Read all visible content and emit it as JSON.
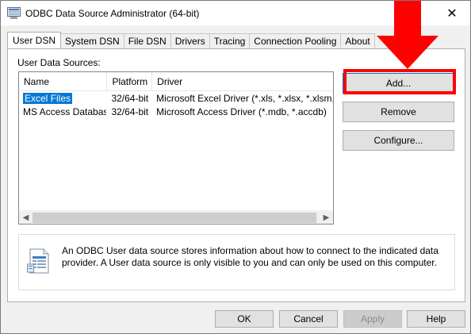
{
  "window": {
    "title": "ODBC Data Source Administrator (64-bit)",
    "close_glyph": "✕"
  },
  "tabs": [
    {
      "label": "User DSN",
      "active": true
    },
    {
      "label": "System DSN",
      "active": false
    },
    {
      "label": "File DSN",
      "active": false
    },
    {
      "label": "Drivers",
      "active": false
    },
    {
      "label": "Tracing",
      "active": false
    },
    {
      "label": "Connection Pooling",
      "active": false
    },
    {
      "label": "About",
      "active": false
    }
  ],
  "user_dsn": {
    "group_label": "User Data Sources:",
    "columns": [
      "Name",
      "Platform",
      "Driver"
    ],
    "rows": [
      {
        "name": "Excel Files",
        "platform": "32/64-bit",
        "driver": "Microsoft Excel Driver (*.xls, *.xlsx, *.xlsm, *.xlsb)",
        "selected": true
      },
      {
        "name": "MS Access Database",
        "platform": "32/64-bit",
        "driver": "Microsoft Access Driver (*.mdb, *.accdb)",
        "selected": false
      }
    ],
    "buttons": {
      "add": "Add...",
      "remove": "Remove",
      "configure": "Configure..."
    },
    "info_text": "An ODBC User data source stores information about how to connect to the indicated data provider.   A User data source is only visible to you and can only be used on this computer."
  },
  "footer": {
    "ok": "OK",
    "cancel": "Cancel",
    "apply": "Apply",
    "help": "Help"
  },
  "icons": {
    "app": "odbc-app-icon",
    "info": "data-sheet-icon",
    "annotation": "red-arrow"
  },
  "colors": {
    "selection": "#0078d7",
    "annotation": "#ff0000",
    "button_face": "#e1e1e1"
  }
}
